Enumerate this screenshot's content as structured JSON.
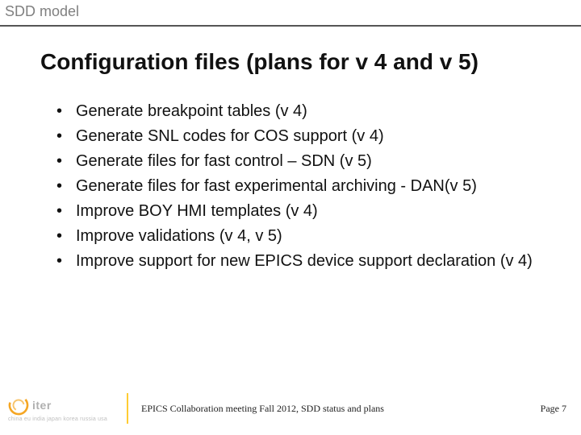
{
  "header": {
    "label": "SDD model"
  },
  "title": "Configuration files (plans for v 4 and v 5)",
  "bullets": [
    "Generate breakpoint tables (v 4)",
    "Generate SNL codes for COS support (v 4)",
    "Generate files for fast control – SDN (v 5)",
    "Generate files for fast experimental archiving - DAN(v 5)",
    "Improve BOY HMI templates (v 4)",
    "Improve validations (v 4, v 5)",
    "Improve support for new EPICS device support declaration (v 4)"
  ],
  "footer": {
    "logo_text": "iter",
    "countries": "china eu india japan korea russia usa",
    "center": "EPICS Collaboration meeting  Fall 2012, SDD status and plans",
    "page": "Page 7"
  }
}
